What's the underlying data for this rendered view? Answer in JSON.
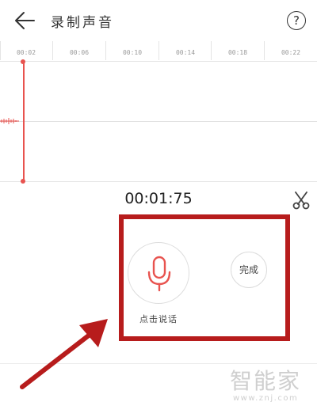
{
  "header": {
    "title": "录制声音",
    "help_label": "?"
  },
  "timeline": {
    "ticks": [
      "00:02",
      "00:06",
      "00:10",
      "00:14",
      "00:18",
      "00:22"
    ]
  },
  "recorder": {
    "elapsed": "00:01:75",
    "record_label": "点击说话",
    "done_label": "完成"
  },
  "watermark": {
    "text": "智能家",
    "url": "www.znj.com"
  },
  "colors": {
    "accent": "#e8534f",
    "highlight_box": "#b71c1c"
  }
}
